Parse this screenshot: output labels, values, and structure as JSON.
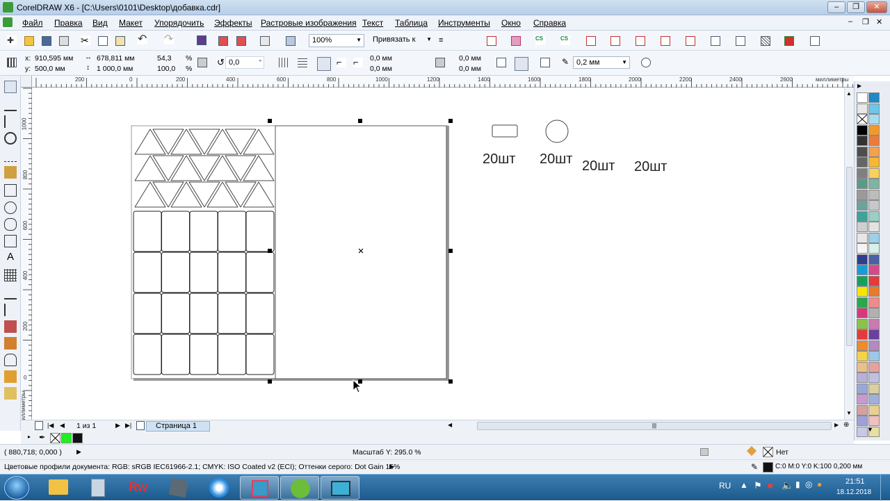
{
  "window": {
    "title": "CorelDRAW X6 - [C:\\Users\\0101\\Desktop\\добавка.cdr]",
    "minimize": "–",
    "restore": "❐",
    "close": "✕"
  },
  "menu": [
    "Файл",
    "Правка",
    "Вид",
    "Макет",
    "Упорядочить",
    "Эффекты",
    "Растровые изображения",
    "Текст",
    "Таблица",
    "Инструменты",
    "Окно",
    "Справка"
  ],
  "toolbar": {
    "zoom": "100%",
    "snap": "Привязать к"
  },
  "props": {
    "x_label": "x:",
    "x": "910,595 мм",
    "y_label": "y:",
    "y": "500,0 мм",
    "w": "678,811 мм",
    "h": "1 000,0 мм",
    "sx": "54,3",
    "sy": "100,0",
    "pct": "%",
    "rotation": "0,0",
    "deg": "°",
    "corner1": "0,0 мм",
    "corner2": "0,0 мм",
    "corner3": "0,0 мм",
    "corner4": "0,0 мм",
    "outline": "0,2 мм"
  },
  "ruler": {
    "units": "миллиметры",
    "h_ticks": [
      "200",
      "0",
      "200",
      "400",
      "600",
      "800",
      "1000",
      "1200",
      "1400",
      "1600",
      "1800",
      "2000",
      "2200",
      "2400",
      "2600"
    ],
    "v_ticks": [
      "1000",
      "800",
      "600",
      "400",
      "200",
      "0"
    ],
    "v_units": "миллиметры"
  },
  "canvas": {
    "captions": [
      "20шт",
      "20шт",
      "20шт",
      "20шт"
    ]
  },
  "pagebar": {
    "page_of": "1 из 1",
    "page_tab": "Страница 1"
  },
  "status": {
    "cursor": "( 880,718; 0,000 )",
    "scale": "Масштаб Y: 295.0 %",
    "fill_none": "Нет",
    "profiles": "Цветовые профили документа: RGB: sRGB IEC61966-2.1; CMYK: ISO Coated v2 (ECI); Оттенки серого: Dot Gain 15%",
    "outline_info": "C:0 M:0 Y:0 K:100  0,200 мм"
  },
  "taskbar": {
    "lang": "RU",
    "time": "21:51",
    "date": "18.12.2018"
  },
  "palette_colors": [
    [
      "#ffffff",
      "#1e88c8"
    ],
    [
      "#e8e8e8",
      "#6fc6e8"
    ],
    [
      "none",
      "#a6dcf0"
    ],
    [
      "#000000",
      "#f19a2a"
    ],
    [
      "#333333",
      "#ee7a3a"
    ],
    [
      "#4d4d4d",
      "#f4a14a"
    ],
    [
      "#666666",
      "#f7b733"
    ],
    [
      "#808080",
      "#fad15a"
    ],
    [
      "#5b9a8a",
      "#7fb4a0"
    ],
    [
      "#9a9a9a",
      "#bcbcbc"
    ],
    [
      "#6ea29a",
      "#c8c8c8"
    ],
    [
      "#3fa39c",
      "#9bcfc6"
    ],
    [
      "#cfcfcf",
      "#e2e2e2"
    ],
    [
      "#e6e6e6",
      "#9bd0ea"
    ],
    [
      "#f5f5f5",
      "#d9efe9"
    ],
    [
      "#2f3d8f",
      "#4a5fa8"
    ],
    [
      "#1b9ad8",
      "#d44a8e"
    ],
    [
      "#17a05a",
      "#e53a3a"
    ],
    [
      "#f7e600",
      "#e97a2a"
    ],
    [
      "#2aa84a",
      "#f08b8b"
    ],
    [
      "#d63a7a",
      "#b0b0b0"
    ],
    [
      "#8bc34a",
      "#c97ab0"
    ],
    [
      "#e53a3a",
      "#6a3fa0"
    ],
    [
      "#f08a2a",
      "#b58ac0"
    ],
    [
      "#f4d24a",
      "#9ec8e8"
    ],
    [
      "#e8c08a",
      "#e9a0a0"
    ],
    [
      "#b8b0d8",
      "#c0c0e0"
    ],
    [
      "#9aa8d8",
      "#d8d0a0"
    ],
    [
      "#c89ad0",
      "#a0b0d8"
    ],
    [
      "#d4a0a0",
      "#e8d090"
    ],
    [
      "#a0a0d8",
      "#f0c0c0"
    ],
    [
      "#c8c8e8",
      "#e8e0a0"
    ]
  ]
}
